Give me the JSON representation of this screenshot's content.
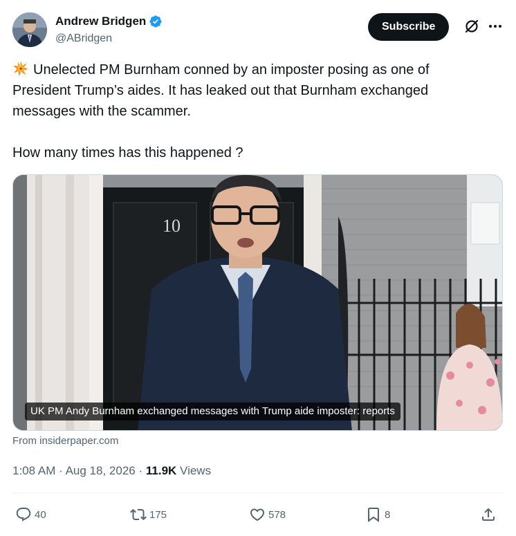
{
  "author": {
    "name": "Andrew Bridgen",
    "handle": "@ABridgen"
  },
  "subscribe_label": "Subscribe",
  "tweet": {
    "line1": "Unelected PM Burnham conned by an imposter posing as one of",
    "line2": "President Trump’s aides. It has leaked out that Burnham exchanged",
    "line3": "messages with the scammer.",
    "line4": "How many times has this happened ?"
  },
  "media": {
    "door_number": "10",
    "caption": "UK PM Andy Burnham exchanged messages with Trump aide imposter: reports"
  },
  "source": "From insiderpaper.com",
  "meta": {
    "time": "1:08 AM",
    "separator": "·",
    "date": "Aug 18, 2026",
    "views_count": "11.9K",
    "views_label": "Views"
  },
  "actions": {
    "replies": "40",
    "reposts": "175",
    "likes": "578",
    "bookmarks": "8"
  },
  "colors": {
    "text": "#0f1419",
    "secondary": "#536471",
    "verified": "#1d9bf0",
    "subscribe_bg": "#0f1419"
  },
  "icons": [
    "verified-badge-icon",
    "grok-icon",
    "more-icon",
    "collision-emoji",
    "reply-icon",
    "repost-icon",
    "like-icon",
    "bookmark-icon",
    "share-icon"
  ]
}
